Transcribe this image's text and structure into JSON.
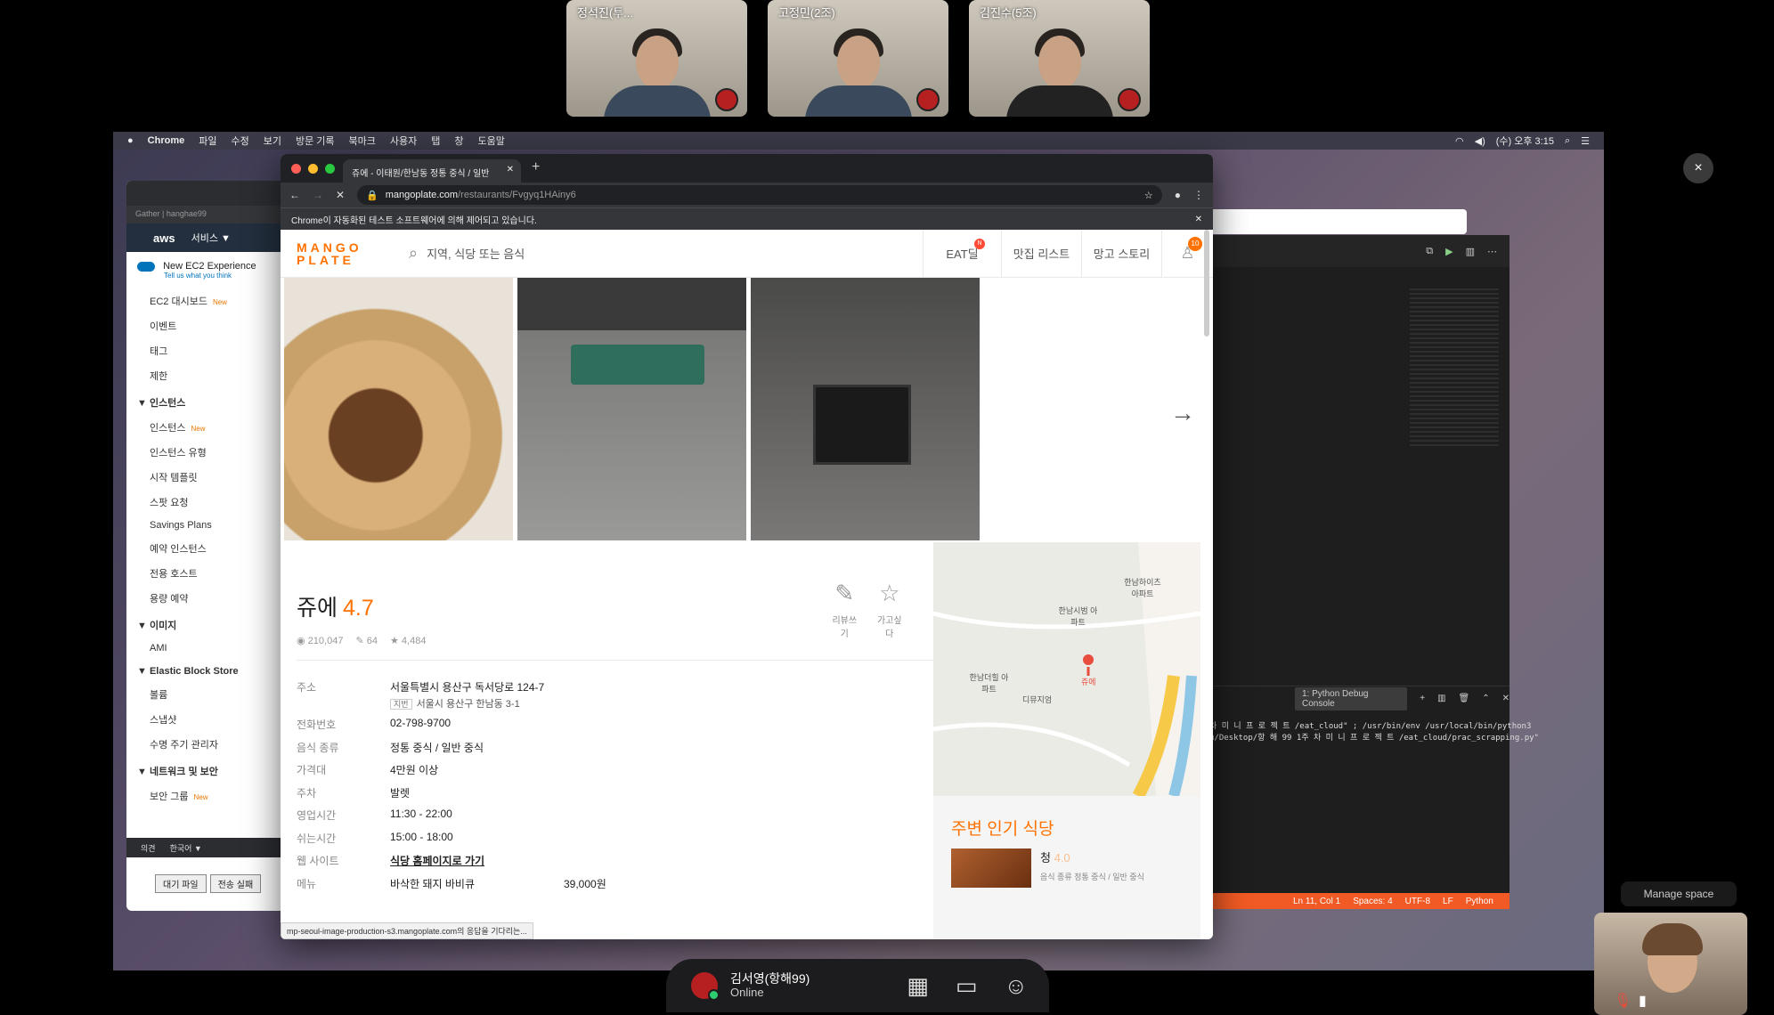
{
  "video_tiles": [
    {
      "name": "정석진(투..."
    },
    {
      "name": "고정민(2조)"
    },
    {
      "name": "김진수(5조)"
    }
  ],
  "menubar": {
    "apple": "",
    "items": [
      "Chrome",
      "파일",
      "수정",
      "보기",
      "방문 기록",
      "북마크",
      "사용자",
      "탭",
      "창",
      "도움말"
    ],
    "clock": "(수) 오후 3:15"
  },
  "aws": {
    "url": "Gather | hanghae99",
    "logo": "aws",
    "services": "서비스 ▼",
    "experience_title": "New EC2 Experience",
    "experience_sub": "Tell us what you think",
    "nav": [
      {
        "type": "item",
        "label": "EC2 대시보드",
        "new": "New"
      },
      {
        "type": "item",
        "label": "이벤트"
      },
      {
        "type": "item",
        "label": "태그"
      },
      {
        "type": "item",
        "label": "제한"
      },
      {
        "type": "sect",
        "label": "▼ 인스턴스"
      },
      {
        "type": "item",
        "label": "인스턴스",
        "new": "New"
      },
      {
        "type": "item",
        "label": "인스턴스 유형"
      },
      {
        "type": "item",
        "label": "시작 템플릿"
      },
      {
        "type": "item",
        "label": "스팟 요청"
      },
      {
        "type": "item",
        "label": "Savings Plans"
      },
      {
        "type": "item",
        "label": "예약 인스턴스"
      },
      {
        "type": "item",
        "label": "전용 호스트"
      },
      {
        "type": "item",
        "label": "용량 예약"
      },
      {
        "type": "sect",
        "label": "▼ 이미지"
      },
      {
        "type": "item",
        "label": "AMI"
      },
      {
        "type": "sect",
        "label": "▼ Elastic Block Store"
      },
      {
        "type": "item",
        "label": "볼륨"
      },
      {
        "type": "item",
        "label": "스냅샷"
      },
      {
        "type": "item",
        "label": "수명 주기 관리자"
      },
      {
        "type": "sect",
        "label": "▼ 네트워크 및 보안"
      },
      {
        "type": "item",
        "label": "보안 그룹",
        "new": "New"
      }
    ],
    "footer_feedback": "의견",
    "footer_lang": "한국어 ▼",
    "bottom_tabs": [
      "대기 파일",
      "전송 실패"
    ]
  },
  "chrome": {
    "tab_title": "쥬에 - 이태원/한남동 정통 중식 / 일반",
    "url_host": "mangoplate.com",
    "url_path": "/restaurants/Fvgyq1HAiny6",
    "infobar": "Chrome이 자동화된 테스트 소프트웨어에 의해 제어되고 있습니다."
  },
  "mangoplate": {
    "logo_line1": "MANGO",
    "logo_line2": "PLATE",
    "search_placeholder": "지역, 식당 또는 음식",
    "nav": [
      "EAT딜",
      "맛집 리스트",
      "망고 스토리"
    ],
    "eat_badge": "N",
    "profile_badge": "10",
    "restaurant": {
      "name": "쥬에",
      "rating": "4.7",
      "views": "210,047",
      "reviews": "64",
      "wants": "4,484",
      "write_review": "리뷰쓰기",
      "want_to_go": "가고싶다"
    },
    "info": {
      "addr_label": "주소",
      "addr": "서울특별시 용산구 독서당로 124-7",
      "jibun_tag": "지번",
      "jibun": "서울시 용산구 한남동 3-1",
      "phone_label": "전화번호",
      "phone": "02-798-9700",
      "food_label": "음식 종류",
      "food": "정통 중식 / 일반 중식",
      "price_label": "가격대",
      "price": "4만원 이상",
      "parking_label": "주차",
      "parking": "발렛",
      "hours_label": "영업시간",
      "hours": "11:30 - 22:00",
      "break_label": "쉬는시간",
      "break": "15:00 - 18:00",
      "web_label": "웹 사이트",
      "web": "식당 홈페이지로 가기",
      "menu_label": "메뉴",
      "menu_item": "바삭한 돼지 바비큐",
      "menu_price": "39,000원"
    },
    "map_labels": [
      "한남하이츠 아파트",
      "한남시범 아파트",
      "한남더힐 아파트",
      "디뮤지엄",
      "쥬에"
    ],
    "nearby_title": "주변 인기 식당",
    "nearby_name": "청",
    "nearby_rating": "4.0",
    "nearby_sub": "음식 종류 정통 중식 / 일반 중식",
    "status_url": "mp-seoul-image-production-s3.mangoplate.com의 응답을 기다리는..."
  },
  "vscode": {
    "panel_select": "1: Python Debug Console",
    "terminal": "차 미 니 프 로 젝 트 /eat_cloud\" ; /usr/bin/env /usr/local/bin/python3\nu/Desktop/항 해 99 1주 차 미 니 프 로 젝 트 /eat_cloud/prac_scrapping.py\"",
    "status": [
      "Ln 11, Col 1",
      "Spaces: 4",
      "UTF-8",
      "LF",
      "Python"
    ]
  },
  "gather": {
    "user_name": "김서영(항해99)",
    "user_status": "Online",
    "manage_space": "Manage space",
    "close": "×"
  },
  "colors": {
    "accent": "#ff7100",
    "vscode_status": "#f15a24",
    "aws_nav": "#232f3e"
  }
}
